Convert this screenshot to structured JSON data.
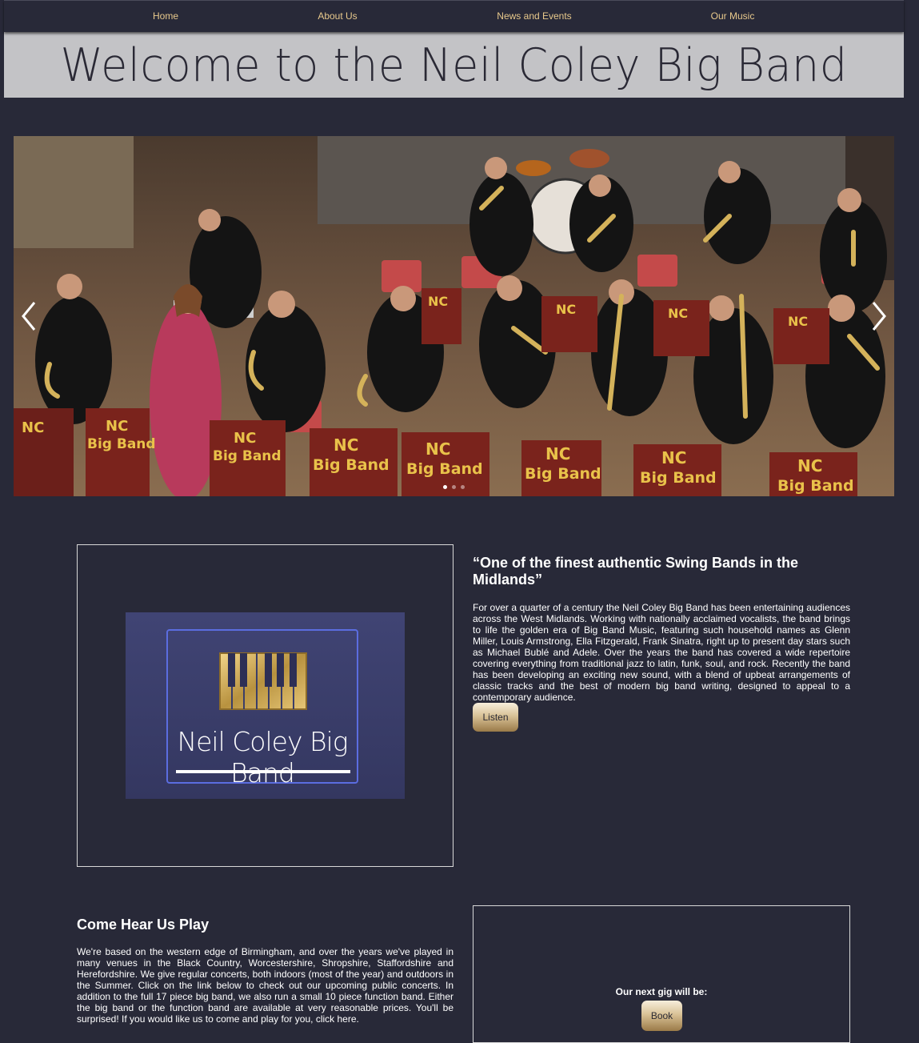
{
  "nav": {
    "items": [
      "Home",
      "About Us",
      "News and Events",
      "Our Music"
    ]
  },
  "banner": {
    "title": "Welcome to the Neil Coley Big Band"
  },
  "carousel": {
    "prev_icon": "chevron-left-icon",
    "next_icon": "chevron-right-icon",
    "slide_count": 3,
    "active_slide": 1,
    "stand_text_line1": "NC",
    "stand_text_line2": "Big Band"
  },
  "logo": {
    "name": "Neil Coley Big Band"
  },
  "intro": {
    "quote": "“One of the finest authentic Swing Bands in the Midlands”",
    "body": "For over a quarter of a century the Neil Coley Big Band has been entertaining audiences across the West Midlands. Working with nationally acclaimed vocalists, the band brings to life the golden era of Big Band Music, featuring such household names as Glenn Miller, Louis Armstrong, Ella Fitzgerald, Frank Sinatra, right up to present day stars such as Michael Bublé and Adele. Over the years the band has covered a wide repertoire covering everything from traditional jazz to latin, funk, soul, and rock. Recently the band has been developing an exciting new sound, with a blend of upbeat arrangements of classic tracks and the best of modern big band writing, designed to appeal to a contemporary audience.",
    "button": "Listen"
  },
  "play": {
    "heading": "Come Hear Us Play",
    "body": "We're based on the western edge of Birmingham, and over the years we've played in many venues in the Black Country, Worcestershire, Shropshire, Staffordshire and Herefordshire. We give regular concerts, both indoors (most of the year) and outdoors in the Summer. Click on the link below to check out our upcoming public concerts. In addition to the full 17 piece big band, we also run a small 10 piece function band. Either the big band or the function band are available at very reasonable prices. You'll be surprised! If you would like us to come and play for you, click here."
  },
  "gig": {
    "label": "Our next gig will be:",
    "button": "Book"
  },
  "colors": {
    "background": "#282938",
    "nav_text": "#e8c98c",
    "banner_bg": "#c3c3c6",
    "button_gold": "#d9c297"
  }
}
